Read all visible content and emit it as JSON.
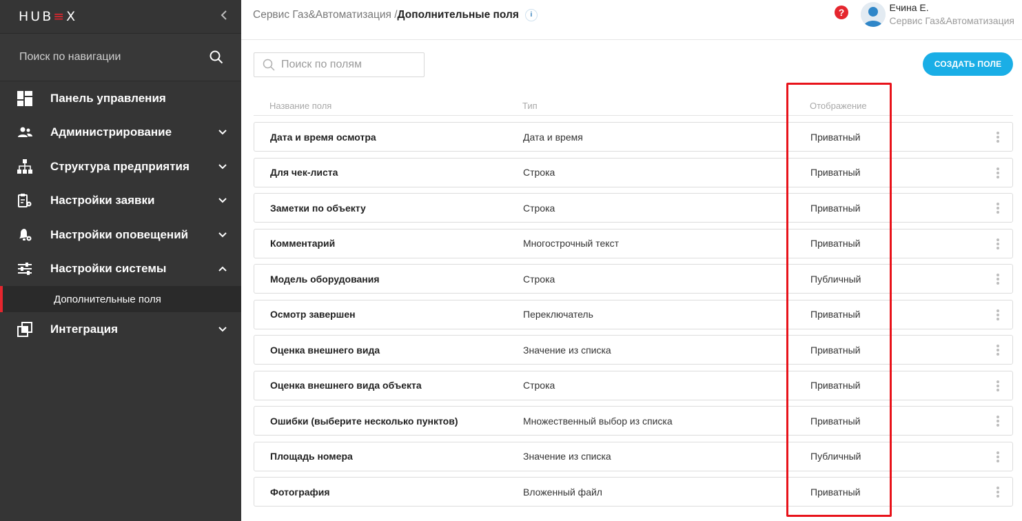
{
  "brand": {
    "logo_text_1": "HUB",
    "logo_accent": "≡",
    "logo_text_2": "X",
    "accent_color": "#e5262e"
  },
  "sidebar": {
    "search_label": "Поиск по навигации",
    "items": [
      {
        "label": "Панель управления",
        "icon": "dashboard-icon",
        "expandable": false
      },
      {
        "label": "Администрирование",
        "icon": "users-icon",
        "expandable": true
      },
      {
        "label": "Структура предприятия",
        "icon": "org-structure-icon",
        "expandable": true
      },
      {
        "label": "Настройки заявки",
        "icon": "request-settings-icon",
        "expandable": true
      },
      {
        "label": "Настройки оповещений",
        "icon": "notification-settings-icon",
        "expandable": true
      },
      {
        "label": "Настройки системы",
        "icon": "system-settings-icon",
        "expandable": true,
        "expanded": true
      },
      {
        "label": "Интеграция",
        "icon": "integration-icon",
        "expandable": true
      }
    ],
    "active_sub_item": "Дополнительные поля"
  },
  "header": {
    "breadcrumb_parent": "Сервис Газ&Автоматизация /",
    "breadcrumb_current": "Дополнительные поля",
    "info_glyph": "i",
    "user_name": "Ечина Е.",
    "user_org": "Сервис Газ&Автоматизация"
  },
  "toolbar": {
    "search_placeholder": "Поиск по полям",
    "create_label": "СОЗДАТЬ ПОЛЕ",
    "create_color": "#1aaee6"
  },
  "table": {
    "columns": [
      "Название поля",
      "Тип",
      "Отображение"
    ],
    "rows": [
      [
        "Дата и время осмотра",
        "Дата и время",
        "Приватный"
      ],
      [
        "Для чек-листа",
        "Строка",
        "Приватный"
      ],
      [
        "Заметки по объекту",
        "Строка",
        "Приватный"
      ],
      [
        "Комментарий",
        "Многострочный текст",
        "Приватный"
      ],
      [
        "Модель оборудования",
        "Строка",
        "Публичный"
      ],
      [
        "Осмотр завершен",
        "Переключатель",
        "Приватный"
      ],
      [
        "Оценка внешнего вида",
        "Значение из списка",
        "Приватный"
      ],
      [
        "Оценка внешнего вида объекта",
        "Строка",
        "Приватный"
      ],
      [
        "Ошибки (выберите несколько пунктов)",
        "Множественный выбор из списка",
        "Приватный"
      ],
      [
        "Площадь номера",
        "Значение из списка",
        "Публичный"
      ],
      [
        "Фотография",
        "Вложенный файл",
        "Приватный"
      ]
    ]
  },
  "annotation_color": "#e8121a"
}
